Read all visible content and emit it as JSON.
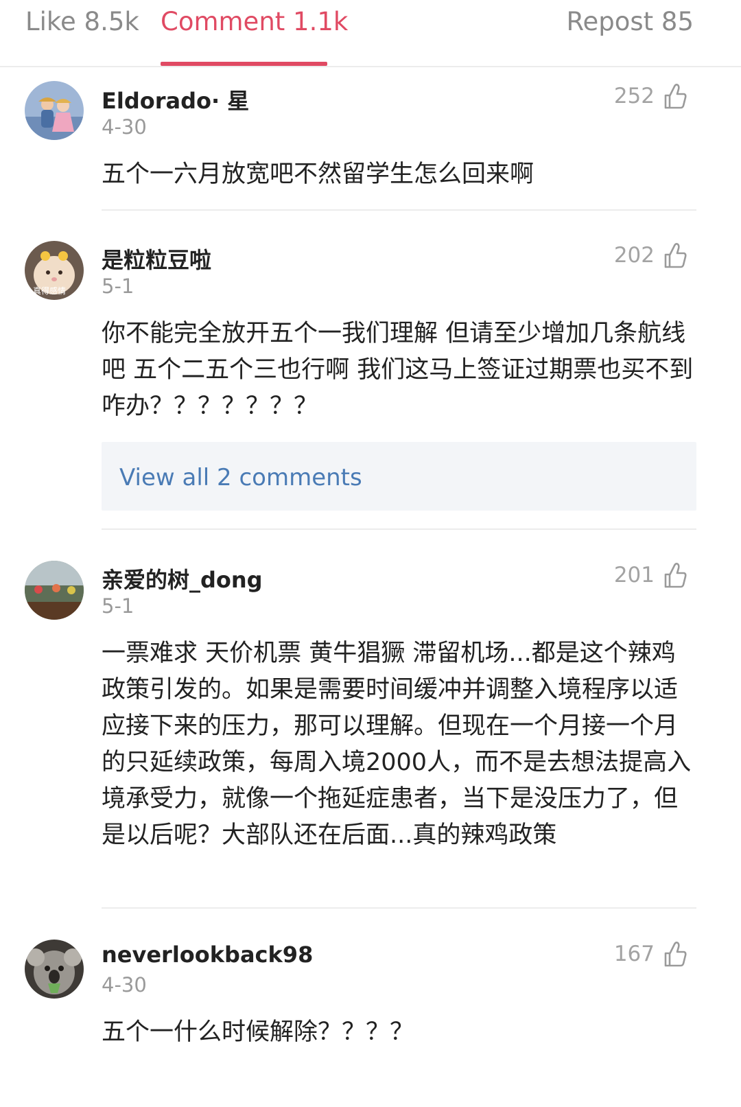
{
  "tabs": {
    "like": "Like 8.5k",
    "comment": "Comment 1.1k",
    "repost": "Repost 85",
    "active": "comment",
    "active_color": "#e04a63"
  },
  "comments": [
    {
      "username": "Eldorado· 星",
      "date": "4-30",
      "likes": "252",
      "text": "五个一六月放宽吧不然留学生怎么回来啊",
      "avatar": "avatar-image"
    },
    {
      "username": "是粒粒豆啦",
      "date": "5-1",
      "likes": "202",
      "text": "你不能完全放开五个一我们理解 但请至少增加几条航线吧 五个二五个三也行啊 我们这马上签证过期票也买不到 咋办？？？？？？？",
      "avatar": "avatar-image",
      "avatar_caption": "真得感情",
      "view_all": "View all 2 comments"
    },
    {
      "username": "亲爱的树_dong",
      "date": "5-1",
      "likes": "201",
      "text": "一票难求 天价机票 黄牛猖獗 滞留机场...都是这个辣鸡政策引发的。如果是需要时间缓冲并调整入境程序以适应接下来的压力，那可以理解。但现在一个月接一个月的只延续政策，每周入境2000人，而不是去想法提高入境承受力，就像一个拖延症患者，当下是没压力了，但是以后呢？大部队还在后面...真的辣鸡政策",
      "avatar": "avatar-image"
    },
    {
      "username": "neverlookback98",
      "date": "4-30",
      "likes": "167",
      "text": "五个一什么时候解除？？？？",
      "avatar": "avatar-image"
    }
  ],
  "icons": {
    "like": "thumbs-up-icon"
  },
  "colors": {
    "link": "#4a7bb5",
    "muted": "#9a9a9a"
  }
}
